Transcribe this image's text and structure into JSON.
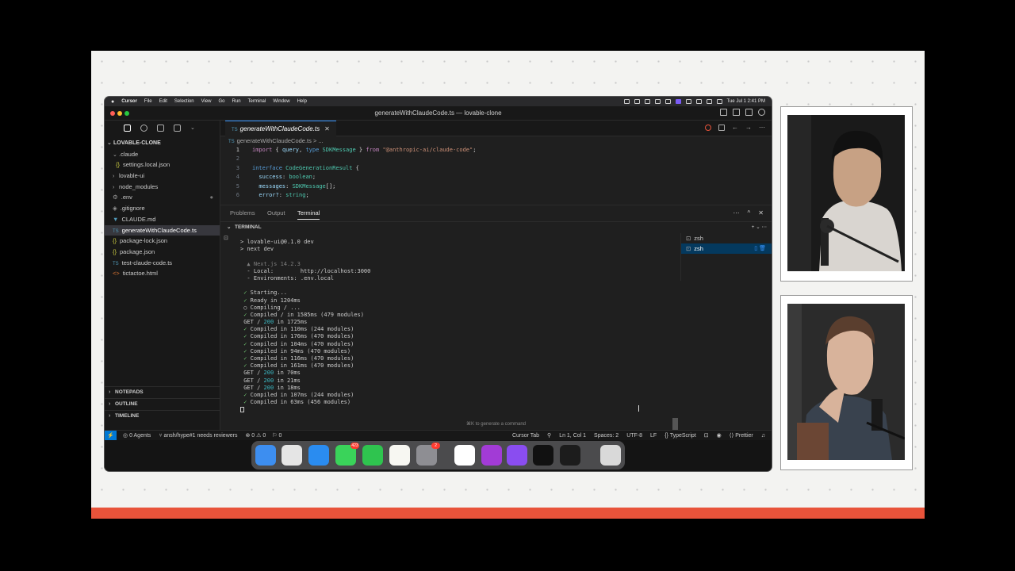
{
  "menubar": {
    "app": "Cursor",
    "items": [
      "File",
      "Edit",
      "Selection",
      "View",
      "Go",
      "Run",
      "Terminal",
      "Window",
      "Help"
    ],
    "clock": "Tue Jul 1  2:41 PM"
  },
  "window": {
    "title": "generateWithClaudeCode.ts — lovable-clone"
  },
  "explorer": {
    "root": "LOVABLE-CLONE",
    "items": [
      ".claude",
      "settings.local.json",
      "lovable-ui",
      "node_modules",
      ".env",
      ".gitignore",
      "CLAUDE.md",
      "generateWithClaudeCode.ts",
      "package-lock.json",
      "package.json",
      "test-claude-code.ts",
      "tictactoe.html"
    ],
    "sections": [
      "NOTEPADS",
      "OUTLINE",
      "TIMELINE"
    ]
  },
  "editor": {
    "tab": "generateWithClaudeCode.ts",
    "tab_lang": "TS",
    "breadcrumb": "generateWithClaudeCode.ts > ...",
    "lines": [
      {
        "n": "1",
        "parts": [
          [
            "kw2",
            "import "
          ],
          [
            "pun",
            "{ "
          ],
          [
            "prop",
            "query"
          ],
          [
            "pun",
            ", "
          ],
          [
            "kw",
            "type "
          ],
          [
            "ty",
            "SDKMessage"
          ],
          [
            "pun",
            " } "
          ],
          [
            "kw2",
            "from "
          ],
          [
            "str",
            "\"@anthropic-ai/claude-code\""
          ],
          [
            "pun",
            ";"
          ]
        ]
      },
      {
        "n": "2",
        "parts": []
      },
      {
        "n": "3",
        "parts": [
          [
            "kw",
            "interface "
          ],
          [
            "ty",
            "CodeGenerationResult"
          ],
          [
            "pun",
            " {"
          ]
        ]
      },
      {
        "n": "4",
        "parts": [
          [
            "prop",
            "  success"
          ],
          [
            "pun",
            ": "
          ],
          [
            "ty",
            "boolean"
          ],
          [
            "pun",
            ";"
          ]
        ]
      },
      {
        "n": "5",
        "parts": [
          [
            "prop",
            "  messages"
          ],
          [
            "pun",
            ": "
          ],
          [
            "ty",
            "SDKMessage"
          ],
          [
            "pun",
            "[];"
          ]
        ]
      },
      {
        "n": "6",
        "parts": [
          [
            "prop",
            "  error?"
          ],
          [
            "pun",
            ": "
          ],
          [
            "ty",
            "string"
          ],
          [
            "pun",
            ";"
          ]
        ]
      }
    ]
  },
  "panel": {
    "tabs": [
      "Problems",
      "Output",
      "Terminal"
    ],
    "terminal_header": "TERMINAL",
    "terminals": [
      "zsh",
      "zsh"
    ],
    "hint": "⌘K to generate a command",
    "output": [
      [
        "pun",
        "> lovable-ui@0.1.0 dev"
      ],
      [
        "pun",
        "> next dev"
      ],
      [
        "pun",
        ""
      ],
      [
        "dim",
        "  ▲ Next.js 14.2.3"
      ],
      [
        "pun",
        "  - Local:        http://localhost:3000"
      ],
      [
        "pun",
        "  - Environments: .env.local"
      ],
      [
        "pun",
        ""
      ],
      [
        "grn",
        " ✓ Starting..."
      ],
      [
        "grn",
        " ✓ Ready in 1204ms"
      ],
      [
        "pun",
        " ○ Compiling / ..."
      ],
      [
        "grn",
        " ✓ Compiled / in 1585ms (479 modules)"
      ],
      [
        "pun",
        " GET / 200 in 1725ms"
      ],
      [
        "grn",
        " ✓ Compiled in 110ms (244 modules)"
      ],
      [
        "grn",
        " ✓ Compiled in 176ms (470 modules)"
      ],
      [
        "grn",
        " ✓ Compiled in 104ms (470 modules)"
      ],
      [
        "grn",
        " ✓ Compiled in 94ms (470 modules)"
      ],
      [
        "grn",
        " ✓ Compiled in 116ms (470 modules)"
      ],
      [
        "grn",
        " ✓ Compiled in 161ms (470 modules)"
      ],
      [
        "pun",
        " GET / 200 in 70ms"
      ],
      [
        "pun",
        " GET / 200 in 21ms"
      ],
      [
        "pun",
        " GET / 200 in 18ms"
      ],
      [
        "grn",
        " ✓ Compiled in 107ms (244 modules)"
      ],
      [
        "grn",
        " ✓ Compiled in 63ms (456 modules)"
      ]
    ]
  },
  "statusbar": {
    "agents": "0 Agents",
    "branch": "ansh/hype#1 needs reviewers",
    "problems": "⊗ 0 ⚠ 0",
    "ports": "⚐ 0",
    "right": [
      "Cursor Tab",
      "Ln 1, Col 1",
      "Spaces: 2",
      "UTF-8",
      "LF",
      "{} TypeScript",
      "Prettier"
    ]
  },
  "dock": {
    "apps": [
      {
        "name": "finder",
        "color": "#3d8ef0"
      },
      {
        "name": "launchpad",
        "color": "#e5e5e5"
      },
      {
        "name": "safari",
        "color": "#2a8cf0"
      },
      {
        "name": "messages",
        "color": "#3ad35a",
        "badge": "423"
      },
      {
        "name": "facetime",
        "color": "#2fc44f"
      },
      {
        "name": "notes",
        "color": "#f7f7f2"
      },
      {
        "name": "system-settings",
        "color": "#8e8e93",
        "badge": "2"
      },
      {
        "name": "notion",
        "color": "#ffffff"
      },
      {
        "name": "elevenlabs",
        "color": "#a23bd6"
      },
      {
        "name": "arc",
        "color": "#8a4df0"
      },
      {
        "name": "cursor",
        "color": "#111111"
      },
      {
        "name": "terminal",
        "color": "#1c1c1c"
      },
      {
        "name": "trash",
        "color": "#d9d9d9"
      }
    ]
  }
}
